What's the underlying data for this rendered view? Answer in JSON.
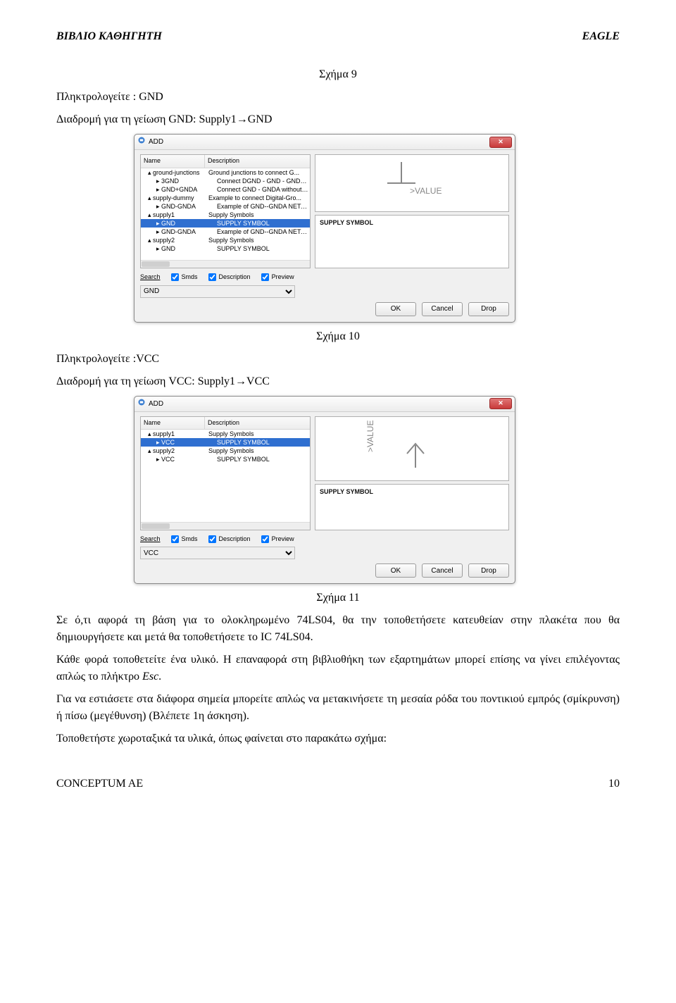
{
  "header": {
    "left": "ΒΙΒΛΙΟ ΚΑΘΗΓΗΤΗ",
    "right": "EAGLE"
  },
  "caption9": "Σχήμα 9",
  "text1": "Πληκτρολογείτε : GND",
  "text2": "Διαδρομή για τη γείωση GND: Supply1→GND",
  "dialog1": {
    "title": "ADD",
    "columns": {
      "name": "Name",
      "desc": "Description"
    },
    "rows": [
      {
        "level": 1,
        "name": "ground-junctions",
        "desc": "Ground junctions to connect G...",
        "sel": false
      },
      {
        "level": 2,
        "name": "3GND",
        "desc": "Connect DGND - GND - GNDA ...",
        "sel": false
      },
      {
        "level": 2,
        "name": "GND+GNDA",
        "desc": "Connect GND - GNDA without ...",
        "sel": false
      },
      {
        "level": 1,
        "name": "supply-dummy",
        "desc": "Example to connect Digital-Gro...",
        "sel": false
      },
      {
        "level": 2,
        "name": "GND-GNDA",
        "desc": "Example of GND--GNDA NET-C...",
        "sel": false
      },
      {
        "level": 1,
        "name": "supply1",
        "desc": "Supply Symbols",
        "sel": false
      },
      {
        "level": 2,
        "name": "GND",
        "desc": "SUPPLY SYMBOL",
        "sel": true
      },
      {
        "level": 2,
        "name": "GND-GNDA",
        "desc": "Example of GND--GNDA NET-C...",
        "sel": false
      },
      {
        "level": 1,
        "name": "supply2",
        "desc": "Supply Symbols",
        "sel": false
      },
      {
        "level": 2,
        "name": "GND",
        "desc": "SUPPLY SYMBOL",
        "sel": false
      }
    ],
    "preview_value": ">VALUE",
    "preview_label": "SUPPLY SYMBOL",
    "search_label": "Search",
    "chk_smds": "Smds",
    "chk_desc": "Description",
    "chk_preview": "Preview",
    "search_value": "GND",
    "btn_ok": "OK",
    "btn_cancel": "Cancel",
    "btn_drop": "Drop"
  },
  "caption10": "Σχήμα 10",
  "text3": "Πληκτρολογείτε :VCC",
  "text4": "Διαδρομή για τη γείωση VCC: Supply1→VCC",
  "dialog2": {
    "title": "ADD",
    "columns": {
      "name": "Name",
      "desc": "Description"
    },
    "rows": [
      {
        "level": 1,
        "name": "supply1",
        "desc": "Supply Symbols",
        "sel": false
      },
      {
        "level": 2,
        "name": "VCC",
        "desc": "SUPPLY SYMBOL",
        "sel": true
      },
      {
        "level": 1,
        "name": "supply2",
        "desc": "Supply Symbols",
        "sel": false
      },
      {
        "level": 2,
        "name": "VCC",
        "desc": "SUPPLY SYMBOL",
        "sel": false
      }
    ],
    "preview_value": ">VALUE",
    "preview_label": "SUPPLY SYMBOL",
    "search_label": "Search",
    "chk_smds": "Smds",
    "chk_desc": "Description",
    "chk_preview": "Preview",
    "search_value": "VCC",
    "btn_ok": "OK",
    "btn_cancel": "Cancel",
    "btn_drop": "Drop"
  },
  "caption11": "Σχήμα 11",
  "para": "Σε ό,τι αφορά τη βάση για το ολοκληρωμένο 74LS04, θα την τοποθετήσετε κατευθείαν  στην πλακέτα που θα δημιουργήσετε και μετά θα τοποθετήσετε το IC 74LS04.",
  "para2a": "Κάθε φορά τοποθετείτε ένα υλικό. Η επαναφορά στη βιβλιοθήκη των εξαρτημάτων μπορεί επίσης να γίνει επιλέγοντας απλώς το πλήκτρο ",
  "para2b": "Esc",
  "para2c": ".",
  "para3": "Για να εστιάσετε στα διάφορα σημεία μπορείτε απλώς να μετακινήσετε τη μεσαία ρόδα του ποντικιού εμπρός (σμίκρυνση) ή πίσω (μεγέθυνση) (Βλέπετε 1η άσκηση).",
  "para4": "Τοποθετήστε χωροταξικά τα υλικά, όπως φαίνεται στο παρακάτω σχήμα:",
  "footer": {
    "left": "CONCEPTUM AE",
    "right": "10"
  }
}
